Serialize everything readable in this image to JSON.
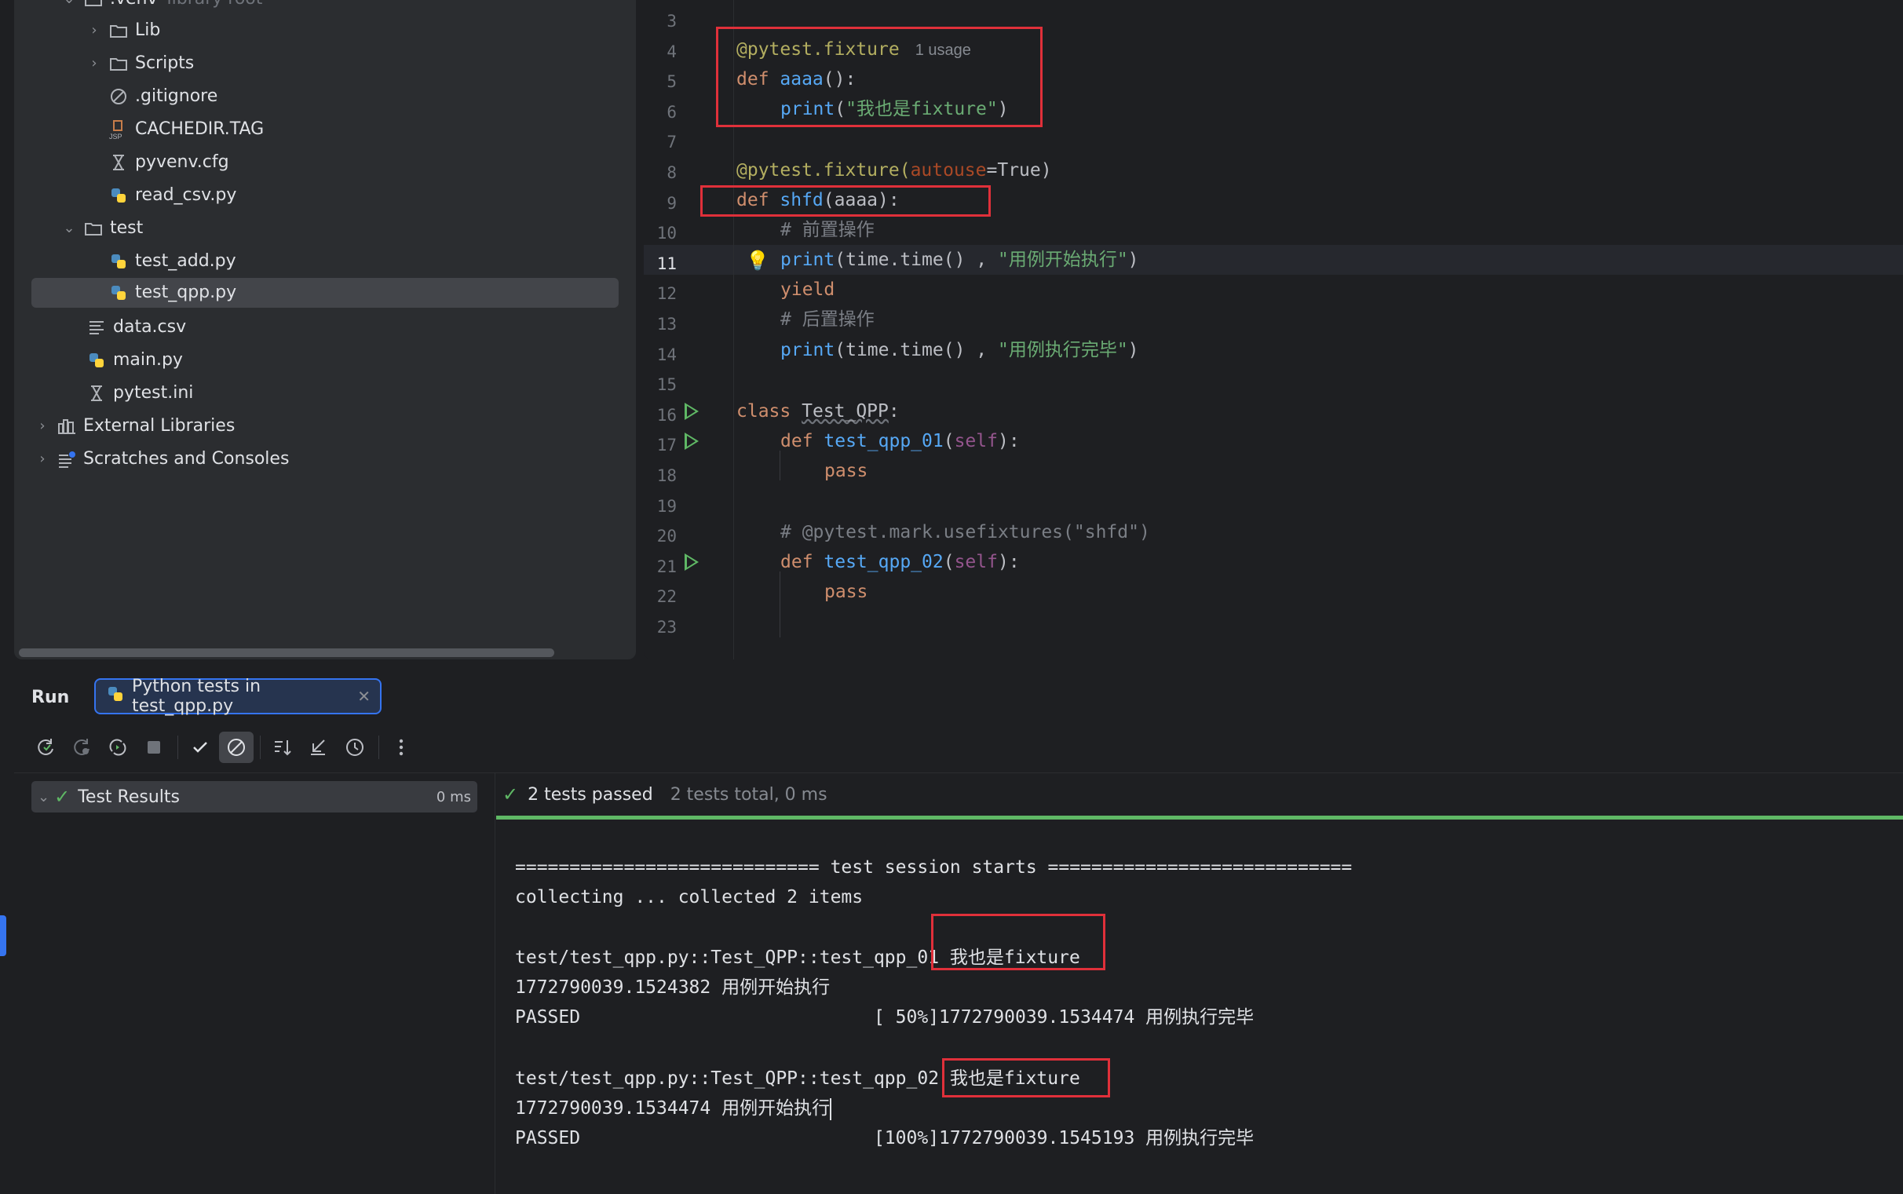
{
  "project_tree": {
    "items": [
      {
        "label": ".venv",
        "suffix": "library root",
        "icon": "folder-icon",
        "chevron": "down"
      },
      {
        "label": "Lib",
        "icon": "folder-icon",
        "chevron": "right"
      },
      {
        "label": "Scripts",
        "icon": "folder-icon",
        "chevron": "right"
      },
      {
        "label": ".gitignore",
        "icon": "ignore-file-icon"
      },
      {
        "label": "CACHEDIR.TAG",
        "icon": "jsp-file-icon"
      },
      {
        "label": "pyvenv.cfg",
        "icon": "config-file-icon"
      },
      {
        "label": "read_csv.py",
        "icon": "python-file-icon"
      },
      {
        "label": "test",
        "icon": "folder-icon",
        "chevron": "down"
      },
      {
        "label": "test_add.py",
        "icon": "python-file-icon"
      },
      {
        "label": "test_qpp.py",
        "icon": "python-file-icon",
        "selected": true
      },
      {
        "label": "data.csv",
        "icon": "text-file-icon"
      },
      {
        "label": "main.py",
        "icon": "python-file-icon"
      },
      {
        "label": "pytest.ini",
        "icon": "config-file-icon"
      },
      {
        "label": "External Libraries",
        "icon": "library-icon",
        "chevron": "right"
      },
      {
        "label": "Scratches and Consoles",
        "icon": "scratches-icon",
        "chevron": "right"
      }
    ]
  },
  "editor": {
    "line_numbers": [
      "3",
      "4",
      "5",
      "6",
      "7",
      "8",
      "9",
      "10",
      "11",
      "12",
      "13",
      "14",
      "15",
      "16",
      "17",
      "18",
      "19",
      "20",
      "21",
      "22",
      "23"
    ],
    "current_line": "11",
    "usage_hint": "1 usage",
    "code": {
      "l4": "@pytest.fixture",
      "l5_kw": "def ",
      "l5_fn": "aaaa",
      "l5_rest": "():",
      "l6_fn": "print",
      "l6_open": "(",
      "l6_str": "\"我也是fixture\"",
      "l6_close": ")",
      "l8_dec": "@pytest.fixture(",
      "l8_param": "autouse",
      "l8_rest": "=True)",
      "l9_kw": "def ",
      "l9_fn": "shfd",
      "l9_rest": "(aaaa):",
      "l10": "# 前置操作",
      "l11_fn": "print",
      "l11_rest": "(time.time() , ",
      "l11_str": "\"用例开始执行\"",
      "l11_close": ")",
      "l12": "yield",
      "l13": "# 后置操作",
      "l14_fn": "print",
      "l14_rest": "(time.time() , ",
      "l14_str": "\"用例执行完毕\"",
      "l14_close": ")",
      "l16_kw": "class ",
      "l16_name": "Test_QPP",
      "l16_rest": ":",
      "l17_kw": "def ",
      "l17_fn": "test_qpp_01",
      "l17_open": "(",
      "l17_self": "self",
      "l17_close": "):",
      "l18": "pass",
      "l20": "# @pytest.mark.usefixtures(\"shfd\")",
      "l21_kw": "def ",
      "l21_fn": "test_qpp_02",
      "l21_open": "(",
      "l21_self": "self",
      "l21_close": "):",
      "l22": "pass"
    }
  },
  "run_panel": {
    "title": "Run",
    "tab_label": "Python tests in test_qpp.py",
    "tab_close": "✕",
    "toolbar": [
      "rerun-icon",
      "rerun-failed-icon",
      "toggle-auto-test-icon",
      "stop-icon",
      "show-passed-icon",
      "show-ignored-icon",
      "sort-icon",
      "collapse-icon",
      "history-icon",
      "more-icon"
    ],
    "results_root": {
      "label": "Test Results",
      "duration": "0 ms"
    },
    "status": {
      "passed": "2 tests passed",
      "total": "2 tests total, 0 ms"
    },
    "console": [
      "============================ test session starts ============================",
      "collecting ... collected 2 items",
      "",
      "test/test_qpp.py::Test_QPP::test_qpp_01 我也是fixture",
      "1772790039.1524382 用例开始执行",
      "PASSED                           [ 50%]1772790039.1534474 用例执行完毕",
      "",
      "test/test_qpp.py::Test_QPP::test_qpp_02 我也是fixture",
      "1772790039.1534474 用例开始执行",
      "PASSED                           [100%]1772790039.1545193 用例执行完毕"
    ]
  },
  "colors": {
    "accent": "#3574f0",
    "pass": "#5fb865",
    "highlight_box": "#e0303a"
  }
}
